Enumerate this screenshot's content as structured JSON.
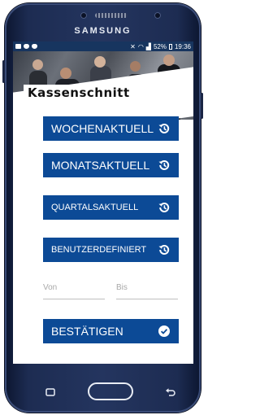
{
  "device": {
    "brand": "SAMSUNG"
  },
  "statusbar": {
    "battery": "52%",
    "time": "19:36"
  },
  "app": {
    "title": "Kassenschnitt"
  },
  "buttons": [
    {
      "label": "WOCHENAKTUELL",
      "icon": "history-icon"
    },
    {
      "label": "MONATSAKTUELL",
      "icon": "history-icon"
    },
    {
      "label": "QUARTALSAKTUELL",
      "icon": "history-icon"
    },
    {
      "label": "BENUTZERDEFINIERT",
      "icon": "history-icon"
    }
  ],
  "range": {
    "from_placeholder": "Von",
    "to_placeholder": "Bis"
  },
  "confirm": {
    "label": "BESTÄTIGEN",
    "icon": "check-circle-icon"
  },
  "colors": {
    "primary": "#0c4a96",
    "statusbar": "#17355f"
  }
}
